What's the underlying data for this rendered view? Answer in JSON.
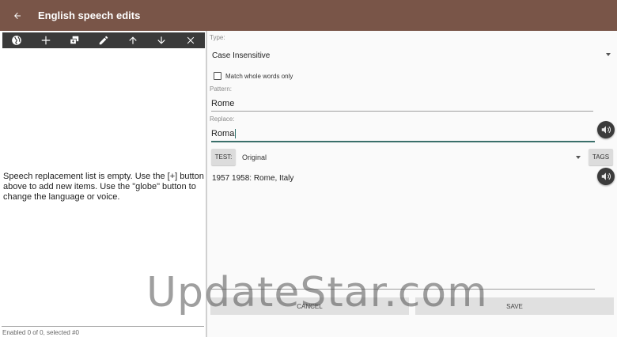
{
  "appbar": {
    "title": "English speech edits"
  },
  "toolbar": {
    "icons": [
      "globe-icon",
      "plus-icon",
      "copy-icon",
      "pencil-icon",
      "arrow-up-icon",
      "arrow-down-icon",
      "close-icon"
    ]
  },
  "left": {
    "empty_message": "Speech replacement list is empty. Use the [+] button above to add new items. Use the \"globe\" button to change the language or voice.",
    "status": "Enabled 0 of 0, selected #0"
  },
  "editor": {
    "type_label": "Type:",
    "type_value": "Case Insensitive",
    "match_whole_words": {
      "label": "Match whole words only",
      "checked": false
    },
    "pattern_label": "Pattern:",
    "pattern_value": "Rome",
    "replace_label": "Replace:",
    "replace_value": "Roma",
    "test_button": "TEST:",
    "test_select_value": "Original",
    "tags_button": "TAGS",
    "result_text": "1957 1958: Rome, Italy",
    "cancel_button": "CANCEL",
    "save_button": "SAVE"
  },
  "watermark": "UpdateStar.com",
  "colors": {
    "appbar": "#795548",
    "toolbar": "#3a3a3a",
    "focus_underline": "#3a6f6a"
  }
}
